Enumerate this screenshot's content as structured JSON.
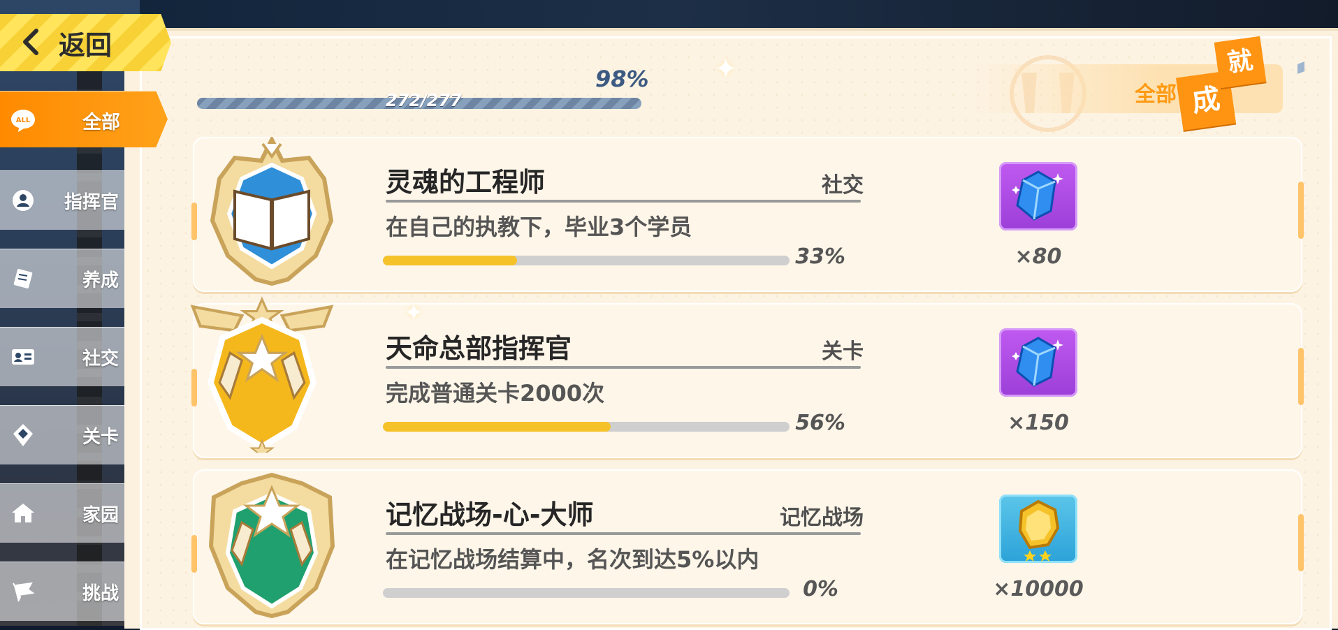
{
  "nav": {
    "back_label": "返回",
    "items": [
      {
        "label": "全部",
        "icon": "all-badge-icon",
        "active": true
      },
      {
        "label": "指挥官",
        "icon": "user-icon",
        "active": false
      },
      {
        "label": "养成",
        "icon": "card-icon",
        "active": false
      },
      {
        "label": "社交",
        "icon": "id-card-icon",
        "active": false
      },
      {
        "label": "关卡",
        "icon": "location-pin-icon",
        "active": false
      },
      {
        "label": "家园",
        "icon": "home-icon",
        "active": false
      },
      {
        "label": "挑战",
        "icon": "flag-icon",
        "active": false
      }
    ],
    "all_badge_text": "ALL"
  },
  "progress": {
    "percent_label": "98%",
    "count_label": "272/277",
    "fraction": 0.98
  },
  "filter": {
    "label": "全部",
    "badge_chars": [
      "成",
      "就"
    ]
  },
  "achievements": [
    {
      "title": "灵魂的工程师",
      "category": "社交",
      "description": "在自己的执教下，毕业3个学员",
      "progress_label": "33%",
      "progress": 0.33,
      "emblem_color": "#2f8fd8",
      "reward_icon": "blue-diamond-icon",
      "reward_bg": "purple",
      "quantity": "×80"
    },
    {
      "title": "天命总部指挥官",
      "category": "关卡",
      "description": "完成普通关卡2000次",
      "progress_label": "56%",
      "progress": 0.56,
      "emblem_color": "#f5b81c",
      "reward_icon": "blue-diamond-icon",
      "reward_bg": "purple",
      "quantity": "×150"
    },
    {
      "title": "记忆战场-心-大师",
      "category": "记忆战场",
      "description": "在记忆战场结算中，名次到达5%以内",
      "progress_label": "0%",
      "progress": 0.0,
      "emblem_color": "#1fa06e",
      "reward_icon": "gold-coin-icon",
      "reward_bg": "cyan",
      "quantity": "×10000"
    }
  ],
  "colors": {
    "accent_orange": "#ff9413",
    "progress_yellow": "#f6c22a",
    "panel_cream": "#fcf1de"
  }
}
